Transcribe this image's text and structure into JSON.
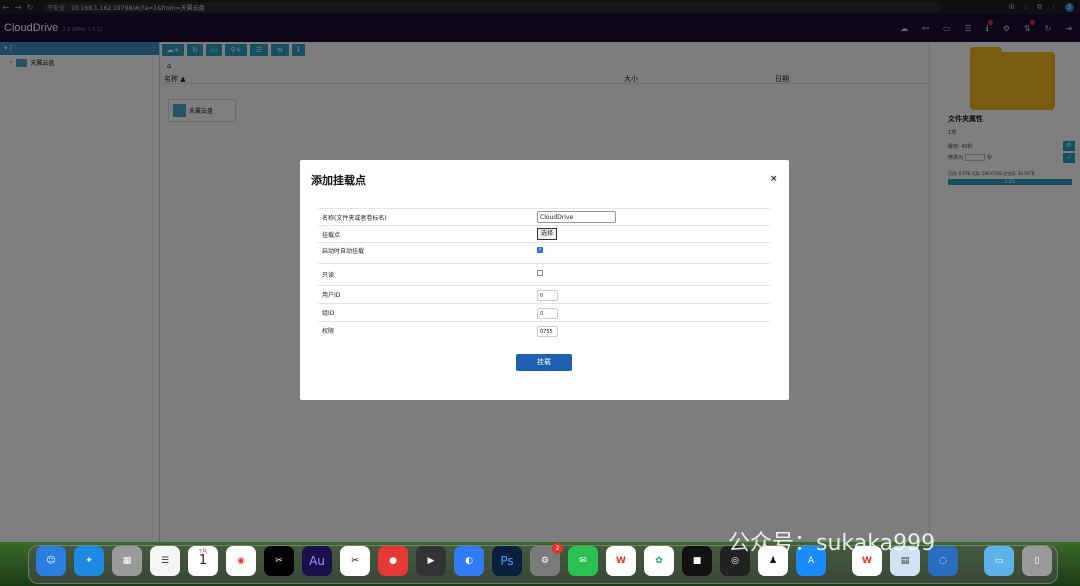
{
  "browser": {
    "insecure_label": "不安全",
    "url": "10.168.1.162:19798/#/?a=1&from=天翼云盘",
    "back": "←",
    "forward": "→",
    "reload": "↻",
    "profile_initial": "S"
  },
  "header": {
    "brand": "CloudDrive",
    "version": "2.6 (0Net 1.5.1)"
  },
  "sidebar": {
    "root_label": "/ ",
    "child_label": "天翼云盘"
  },
  "toolbar": {
    "buttons": [
      "☁+",
      "↻",
      "▭",
      "⚲+",
      "☰",
      "⇆",
      "ℹ"
    ]
  },
  "content": {
    "home_icon": "⌂",
    "columns": {
      "name": "名称 ▲",
      "size": "大小",
      "date": "日期"
    },
    "file_label": "天翼云盘"
  },
  "info_panel": {
    "title": "文件夹属性",
    "line1": "1项",
    "cache_label": "缓存: 40秒",
    "refresh_label": "修改为",
    "refresh_unit": "秒",
    "usage": "已用: 0.07B    可用: 500.67GB    总空间: 16.00TB",
    "usage_bar": "0.0%"
  },
  "modal": {
    "title": "添加挂载点",
    "close": "×",
    "fields": {
      "name_label": "名称(文件夹或者卷标名)",
      "name_value": "CloudDrive",
      "mount_label": "挂载点",
      "choose_button": "选择",
      "auto_mount_label": "启动时自动挂载",
      "readonly_label": "只读",
      "uid_label": "用户ID",
      "uid_value": "0",
      "gid_label": "组ID",
      "gid_value": "0",
      "perm_label": "权限",
      "perm_value": "0755"
    },
    "submit": "挂载"
  },
  "dock": {
    "calendar_month": "7月",
    "calendar_day": "1",
    "settings_badge": "2",
    "watermark": "公众号：sukaka999"
  }
}
